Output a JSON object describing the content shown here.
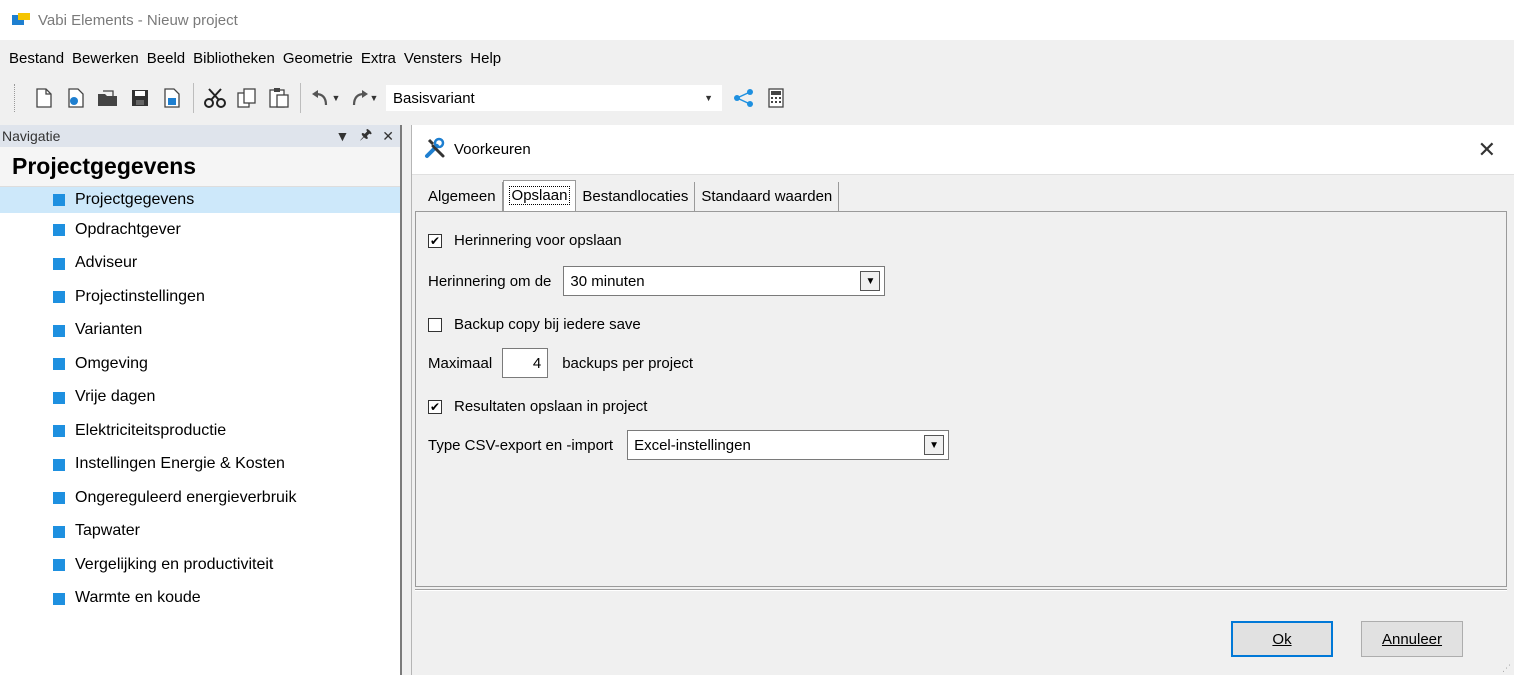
{
  "window": {
    "title": "Vabi Elements - Nieuw project"
  },
  "menu": [
    "Bestand",
    "Bewerken",
    "Beeld",
    "Bibliotheken",
    "Geometrie",
    "Extra",
    "Vensters",
    "Help"
  ],
  "toolbar": {
    "variant": "Basisvariant",
    "icons": [
      "new-icon",
      "new-template-icon",
      "open-icon",
      "save-icon",
      "save-as-icon",
      "cut-icon",
      "copy-icon",
      "paste-icon",
      "undo-icon",
      "redo-icon",
      "share-icon",
      "calculator-icon"
    ]
  },
  "navigation": {
    "header": "Navigatie",
    "section": "Projectgegevens",
    "items": [
      "Projectgegevens",
      "Opdrachtgever",
      "Adviseur",
      "Projectinstellingen",
      "Varianten",
      "Omgeving",
      "Vrije dagen",
      "Elektriciteitsproductie",
      "Instellingen Energie & Kosten",
      "Ongereguleerd energieverbruik",
      "Tapwater",
      "Vergelijking en productiviteit",
      "Warmte en koude"
    ],
    "selected_index": 0,
    "accent_color": "#1e90e0"
  },
  "dialog": {
    "title": "Voorkeuren",
    "tabs": [
      "Algemeen",
      "Opslaan",
      "Bestandlocaties",
      "Standaard waarden"
    ],
    "active_tab": "Opslaan",
    "reminder_checkbox": {
      "label": "Herinnering voor opslaan",
      "checked": true
    },
    "reminder_interval": {
      "label": "Herinnering om de",
      "value": "30 minuten"
    },
    "backup_checkbox": {
      "label": "Backup copy bij iedere save",
      "checked": false
    },
    "max_backups": {
      "prefix": "Maximaal",
      "value": "4",
      "suffix": "backups per project"
    },
    "results_checkbox": {
      "label": "Resultaten opslaan in project",
      "checked": true
    },
    "csv_type": {
      "label": "Type CSV-export en -import",
      "value": "Excel-instellingen"
    },
    "ok_label": "Ok",
    "cancel_label": "Annuleer"
  }
}
